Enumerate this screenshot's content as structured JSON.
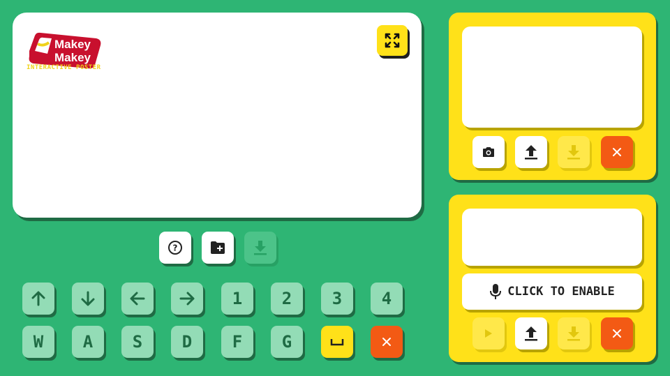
{
  "poster": {
    "logo_line1": "Makey",
    "logo_line2": "Makey",
    "logo_subtitle": "INTERACTIVE POSTER",
    "expand_icon": "fullscreen-icon"
  },
  "toolbar": {
    "help_icon": "help-icon",
    "new_folder_icon": "folder-add-icon",
    "download_icon": "download-icon"
  },
  "keys": {
    "row1": [
      "↑",
      "↓",
      "←",
      "→",
      "1",
      "2",
      "3",
      "4"
    ],
    "row2": [
      "W",
      "A",
      "S",
      "D",
      "F",
      "G"
    ],
    "space_icon": "space-key-icon",
    "clear_icon": "close-icon"
  },
  "camera_panel": {
    "icons": [
      "camera-icon",
      "upload-icon",
      "download-icon",
      "close-icon"
    ]
  },
  "mic_panel": {
    "enable_label": "CLICK TO ENABLE",
    "icons": [
      "play-icon",
      "upload-icon",
      "download-icon",
      "close-icon"
    ]
  },
  "colors": {
    "background": "#2eb574",
    "accent_yellow": "#ffe119",
    "danger_orange": "#f35a14",
    "key_green": "#93dcb6"
  }
}
